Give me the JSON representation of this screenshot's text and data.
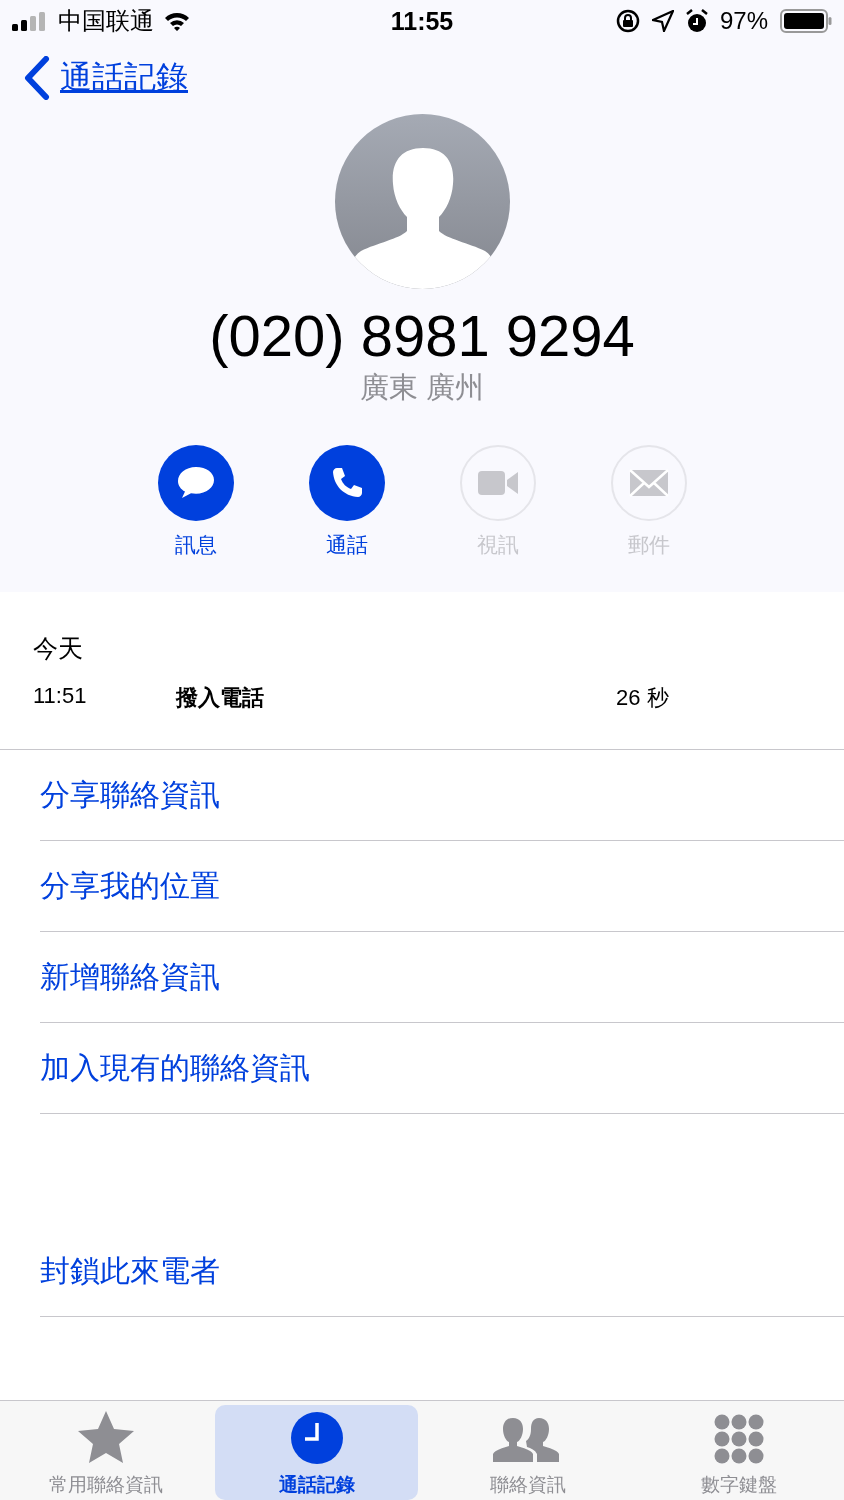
{
  "status_bar": {
    "carrier": "中国联通",
    "time": "11:55",
    "battery": "97%"
  },
  "nav": {
    "back": "通話記錄"
  },
  "contact": {
    "number": "(020) 8981 9294",
    "location": "廣東 廣州"
  },
  "actions": [
    {
      "kind": "message",
      "label": "訊息",
      "disabled": false
    },
    {
      "kind": "call",
      "label": "通話",
      "disabled": false
    },
    {
      "kind": "video",
      "label": "視訊",
      "disabled": true
    },
    {
      "kind": "mail",
      "label": "郵件",
      "disabled": true
    }
  ],
  "call_log": {
    "heading": "今天",
    "rows": [
      {
        "time": "11:51",
        "type": "撥入電話",
        "duration": "26 秒"
      }
    ]
  },
  "options": [
    "分享聯絡資訊",
    "分享我的位置",
    "新增聯絡資訊",
    "加入現有的聯絡資訊"
  ],
  "block": "封鎖此來電者",
  "tabs": [
    {
      "kind": "favorites",
      "label": "常用聯絡資訊",
      "selected": false
    },
    {
      "kind": "recents",
      "label": "通話記錄",
      "selected": true
    },
    {
      "kind": "contacts",
      "label": "聯絡資訊",
      "selected": false
    },
    {
      "kind": "keypad",
      "label": "數字鍵盤",
      "selected": false
    }
  ]
}
